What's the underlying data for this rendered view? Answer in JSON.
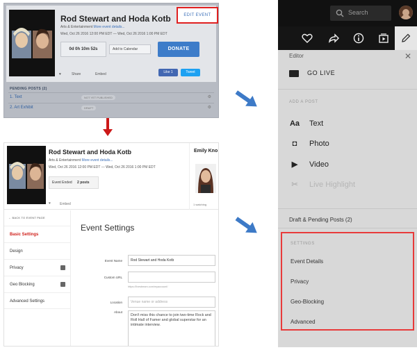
{
  "top_card": {
    "title": "Rod Stewart and Hoda Kotb",
    "category": "Arts & Entertainment",
    "more_details": "More event details...",
    "date": "Wed, Oct 26 2016 12:00 PM EDT — Wed, Oct 26 2016 1:00 PM EDT",
    "countdown": "0d 0h 10m 52s",
    "add_calendar": "Add to Calendar",
    "donate": "DONATE",
    "edit_event": "EDIT EVENT",
    "share": "Share",
    "embed": "Embed",
    "like": "Like 1",
    "tweet": "Tweet",
    "pending_heading": "PENDING POSTS (2)",
    "pending": [
      {
        "name": "1. Text",
        "tag": "NOT YET PUBLISHED"
      },
      {
        "name": "2. Art Exhibit",
        "tag": "DRAFT"
      }
    ]
  },
  "bottom_card": {
    "title": "Rod Stewart and Hoda Kotb",
    "category": "Arts & Entertainment",
    "more_details": "More event details...",
    "date": "Wed, Oct 26 2016 12:00 PM EDT — Wed, Oct 26 2016 1:00 PM EDT",
    "event_ended": "Event Ended",
    "posts": "2 posts",
    "person_name": "Emily Kno",
    "embed": "Embed",
    "watching": "1 watching",
    "back_link": "← BACK TO EVENT PAGE",
    "nav": [
      {
        "label": "Basic Settings",
        "active": true
      },
      {
        "label": "Design",
        "active": false
      },
      {
        "label": "Privacy",
        "active": false
      },
      {
        "label": "Geo Blocking",
        "active": false
      },
      {
        "label": "Advanced Settings",
        "active": false
      }
    ],
    "settings_title": "Event Settings",
    "fields": {
      "event_name_label": "Event Name",
      "event_name_value": "Rod Stewart and Hoda Kotb",
      "custom_url_label": "Custom URL",
      "custom_url_hint": "https://livestream.com/myaccount/",
      "location_label": "Location",
      "location_placeholder": "Venue name or address",
      "about_label": "About",
      "about_value": "Don't miss this chance to join two-time Rock and Roll Hall of Famer and global superstar for an intimate interview."
    }
  },
  "mobile": {
    "search_placeholder": "Search",
    "editor_label": "Editor",
    "go_live": "GO LIVE",
    "add_post_heading": "ADD A POST",
    "post_options": [
      {
        "glyph": "Aa",
        "label": "Text",
        "disabled": false
      },
      {
        "glyph": "◘",
        "label": "Photo",
        "disabled": false
      },
      {
        "glyph": "▶",
        "label": "Video",
        "disabled": false
      },
      {
        "glyph": "✂",
        "label": "Live Highlight",
        "disabled": true
      }
    ],
    "drafts": "Draft & Pending Posts (2)",
    "settings_heading": "SETTINGS",
    "settings_items": [
      "Event Details",
      "Privacy",
      "Geo-Blocking",
      "Advanced"
    ]
  },
  "colors": {
    "highlight_red": "#e83a3a",
    "arrow_blue": "#3d7ac7",
    "arrow_red": "#cc1818",
    "donate_blue": "#3d7cc9"
  }
}
